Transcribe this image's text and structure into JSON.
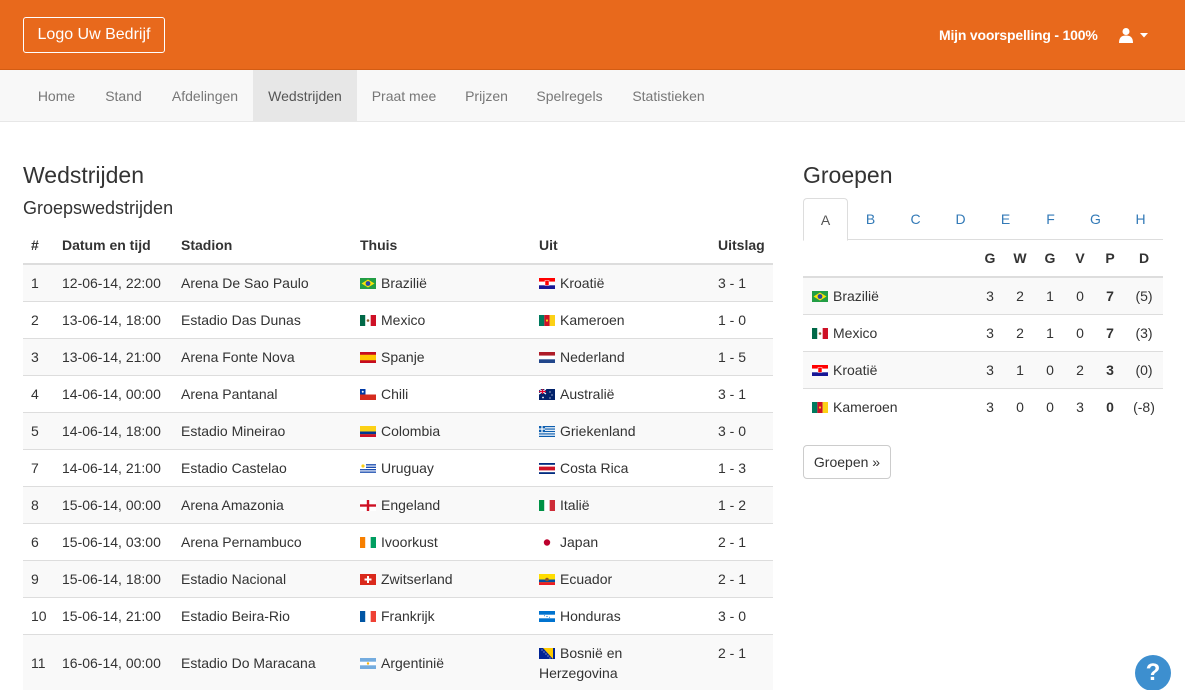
{
  "header": {
    "logo": "Logo Uw Bedrijf",
    "prediction": "Mijn voorspelling - 100%",
    "user_icon": "user-icon"
  },
  "nav": [
    {
      "label": "Home"
    },
    {
      "label": "Stand"
    },
    {
      "label": "Afdelingen"
    },
    {
      "label": "Wedstrijden",
      "active": true
    },
    {
      "label": "Praat mee"
    },
    {
      "label": "Prijzen"
    },
    {
      "label": "Spelregels"
    },
    {
      "label": "Statistieken"
    }
  ],
  "matches": {
    "title": "Wedstrijden",
    "subtitle": "Groepswedstrijden",
    "columns": [
      "#",
      "Datum en tijd",
      "Stadion",
      "Thuis",
      "Uit",
      "Uitslag"
    ],
    "rows": [
      {
        "num": "1",
        "date": "12-06-14, 22:00",
        "stadium": "Arena De Sao Paulo",
        "home": "Brazilië",
        "home_flag": "br",
        "away": "Kroatië",
        "away_flag": "hr",
        "score": "3 - 1"
      },
      {
        "num": "2",
        "date": "13-06-14, 18:00",
        "stadium": "Estadio Das Dunas",
        "home": "Mexico",
        "home_flag": "mx",
        "away": "Kameroen",
        "away_flag": "cm",
        "score": "1 - 0"
      },
      {
        "num": "3",
        "date": "13-06-14, 21:00",
        "stadium": "Arena Fonte Nova",
        "home": "Spanje",
        "home_flag": "es",
        "away": "Nederland",
        "away_flag": "nl",
        "score": "1 - 5"
      },
      {
        "num": "4",
        "date": "14-06-14, 00:00",
        "stadium": "Arena Pantanal",
        "home": "Chili",
        "home_flag": "cl",
        "away": "Australië",
        "away_flag": "au",
        "score": "3 - 1"
      },
      {
        "num": "5",
        "date": "14-06-14, 18:00",
        "stadium": "Estadio Mineirao",
        "home": "Colombia",
        "home_flag": "co",
        "away": "Griekenland",
        "away_flag": "gr",
        "score": "3 - 0"
      },
      {
        "num": "7",
        "date": "14-06-14, 21:00",
        "stadium": "Estadio Castelao",
        "home": "Uruguay",
        "home_flag": "uy",
        "away": "Costa Rica",
        "away_flag": "cr",
        "score": "1 - 3"
      },
      {
        "num": "8",
        "date": "15-06-14, 00:00",
        "stadium": "Arena Amazonia",
        "home": "Engeland",
        "home_flag": "en",
        "away": "Italië",
        "away_flag": "it",
        "score": "1 - 2"
      },
      {
        "num": "6",
        "date": "15-06-14, 03:00",
        "stadium": "Arena Pernambuco",
        "home": "Ivoorkust",
        "home_flag": "ci",
        "away": "Japan",
        "away_flag": "jp",
        "score": "2 - 1"
      },
      {
        "num": "9",
        "date": "15-06-14, 18:00",
        "stadium": "Estadio Nacional",
        "home": "Zwitserland",
        "home_flag": "ch",
        "away": "Ecuador",
        "away_flag": "ec",
        "score": "2 - 1"
      },
      {
        "num": "10",
        "date": "15-06-14, 21:00",
        "stadium": "Estadio Beira-Rio",
        "home": "Frankrijk",
        "home_flag": "fr",
        "away": "Honduras",
        "away_flag": "hn",
        "score": "3 - 0"
      },
      {
        "num": "11",
        "date": "16-06-14, 00:00",
        "stadium": "Estadio Do Maracana",
        "home": "Argentinië",
        "home_flag": "ar",
        "away": "Bosnië en Herzegovina",
        "away_flag": "ba",
        "score": "2 - 1"
      }
    ]
  },
  "groups": {
    "title": "Groepen",
    "tabs": [
      "A",
      "B",
      "C",
      "D",
      "E",
      "F",
      "G",
      "H"
    ],
    "active_tab": "A",
    "columns": [
      "",
      "G",
      "W",
      "G",
      "V",
      "P",
      "D"
    ],
    "rows": [
      {
        "team": "Brazilië",
        "flag": "br",
        "g": "3",
        "w": "2",
        "g2": "1",
        "v": "0",
        "p": "7",
        "d": "(5)"
      },
      {
        "team": "Mexico",
        "flag": "mx",
        "g": "3",
        "w": "2",
        "g2": "1",
        "v": "0",
        "p": "7",
        "d": "(3)"
      },
      {
        "team": "Kroatië",
        "flag": "hr",
        "g": "3",
        "w": "1",
        "g2": "0",
        "v": "2",
        "p": "3",
        "d": "(0)"
      },
      {
        "team": "Kameroen",
        "flag": "cm",
        "g": "3",
        "w": "0",
        "g2": "0",
        "v": "3",
        "p": "0",
        "d": "(-8)"
      }
    ],
    "button": "Groepen »"
  },
  "help_icon": "?",
  "colors": {
    "brand": "#e8691c",
    "link": "#337ab7",
    "help": "#3d8fcf"
  }
}
